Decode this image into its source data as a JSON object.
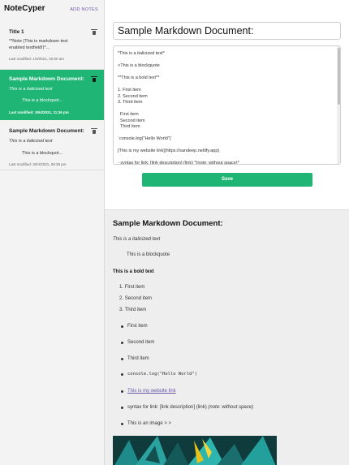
{
  "app": {
    "title": "NoteCyper",
    "add_notes_label": "ADD NOTES"
  },
  "notes": [
    {
      "title": "Title 1",
      "line1": "**Note (This is markdown text",
      "line2": "enabled textfield!)*...",
      "modified": "Last modified: 1/3/2021, 02:00 am"
    },
    {
      "title": "Sample Markdown Document:",
      "line1": "This is a italicized text",
      "line2": "This is a blockquot...",
      "modified": "Last modified: 30/4/2021, 11:36 pm"
    },
    {
      "title": "Sample Markdown Document:",
      "line1": "This is a italicized text",
      "line2": "This is a blockquot...",
      "modified": "Last modified: 30/4/2021, 09:39 pm"
    }
  ],
  "editor": {
    "title_value": "Sample Markdown Document:",
    "body_lines": [
      "*This is a italicized text*",
      "",
      ">This is a blockquote",
      "",
      "**This is a bold text**",
      "",
      "1. First item",
      "2. Second item",
      "3. Third item",
      "",
      "  First item",
      "  Second item",
      "  Third item",
      "",
      "`console.log(\"Hello World\")`",
      "",
      "[This is my website link](https://sandeep.netlify.app)",
      "",
      "- syntax for link: [link description] (link) *(note: without space)*"
    ],
    "save_label": "Save"
  },
  "preview": {
    "title": "Sample Markdown Document:",
    "italic": "This is a italicized text",
    "quote": "This is a blockquote",
    "bold": "This is a bold text",
    "ordered": [
      "First item",
      "Second item",
      "Third item"
    ],
    "ordered_markers": [
      "1.",
      "2.",
      "3."
    ],
    "bullets": [
      "First item",
      "Second item",
      "Third item"
    ],
    "code": "console.log(\"Hello World\")",
    "link": "This is my website link",
    "syntax_text": "syntax for link: [link description] (link) ",
    "syntax_em": "(note: without space)",
    "image_caption": "This is an image > >"
  },
  "colors": {
    "accent": "#1fb575",
    "link": "#6a55a8",
    "sidebar_bg": "#f3f3f3",
    "preview_bg": "#eeeeee"
  }
}
